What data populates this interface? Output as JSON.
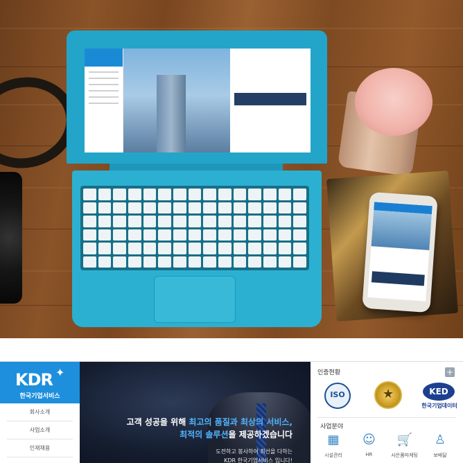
{
  "site": {
    "logo": {
      "mark": "KDR",
      "name": "한국기업서비스"
    },
    "nav": [
      {
        "label": "회사소개"
      },
      {
        "label": "사업소개"
      },
      {
        "label": "인재채용"
      }
    ],
    "hero": {
      "line1_pre": "고객 성공을 위해 ",
      "line1_accent": "최고의 품질과 최상의 서비스,",
      "line2_accent": "최적의 솔루션",
      "line2_post": "을 제공하겠습니다",
      "sub1": "도전하고 봉사하여 최선을 다하는",
      "sub2": "KDR 한국기업서비스 입니다!"
    },
    "cert": {
      "title": "인증현황",
      "plus": "+",
      "iso": "ISO",
      "ked_mark": "KED",
      "ked_name": "한국기업데이터"
    },
    "business": {
      "title": "사업분야",
      "items": [
        {
          "label": "시설관리",
          "icon": "building-icon",
          "glyph": "▦"
        },
        {
          "label": "HR",
          "icon": "person-search-icon",
          "glyph": "☺"
        },
        {
          "label": "사은품마케팅",
          "icon": "cart-icon",
          "glyph": "🛒"
        },
        {
          "label": "보배달",
          "icon": "delivery-person-icon",
          "glyph": "♙"
        }
      ]
    },
    "colors": {
      "brand": "#1d8fdc",
      "accent": "#4fb4ff",
      "dark": "#141c2e"
    }
  }
}
